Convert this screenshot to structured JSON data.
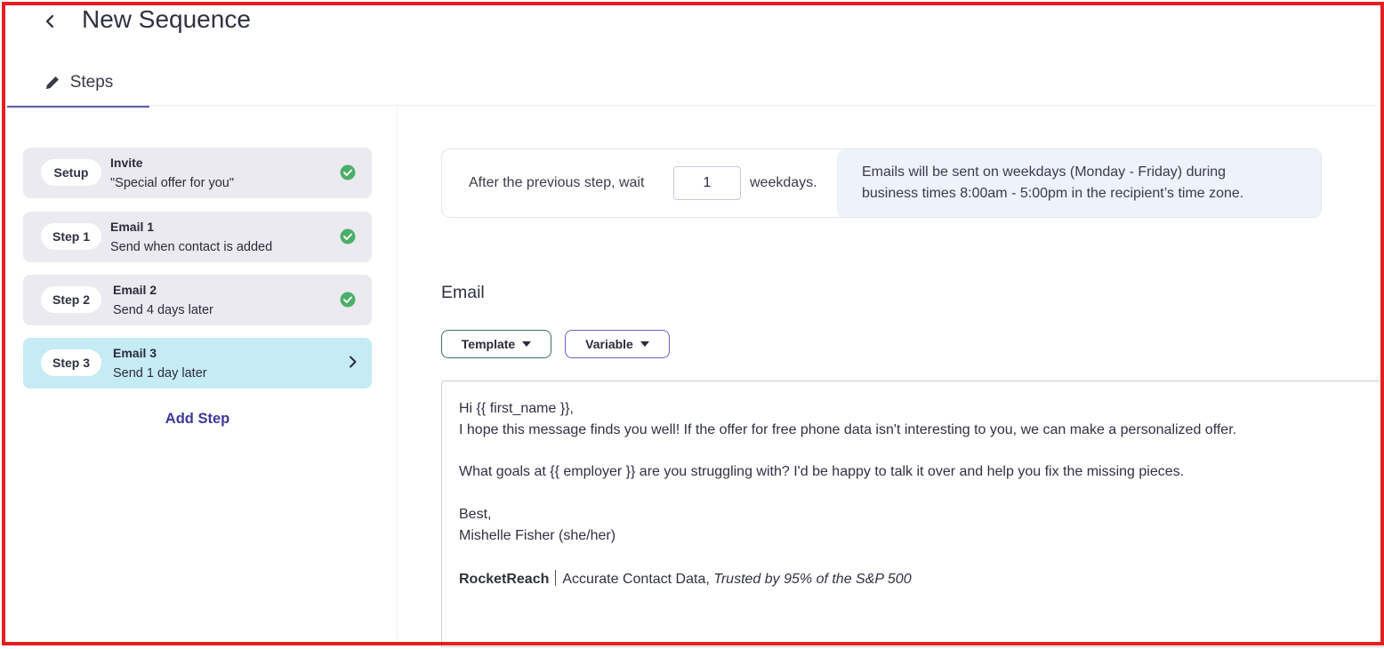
{
  "header": {
    "title": "New Sequence",
    "back_icon": "chevron-left-icon"
  },
  "tabs": [
    {
      "label": "Steps",
      "icon": "pencil-icon",
      "active": true
    }
  ],
  "steps": [
    {
      "pill": "Setup",
      "title": "Invite",
      "subtitle": "\"Special offer for you\"",
      "status": "complete",
      "active": false
    },
    {
      "pill": "Step 1",
      "title": "Email 1",
      "subtitle": "Send when contact is added",
      "status": "complete",
      "active": false
    },
    {
      "pill": "Step 2",
      "title": "Email 2",
      "subtitle": "Send 4 days later",
      "status": "complete",
      "active": false
    },
    {
      "pill": "Step 3",
      "title": "Email 3",
      "subtitle": "Send 1 day later",
      "status": "current",
      "active": true
    }
  ],
  "add_step_label": "Add Step",
  "wait": {
    "prefix": "After the previous step, wait",
    "value": "1",
    "suffix": "weekdays.",
    "info_line1": "Emails will be sent on weekdays (Monday - Friday) during",
    "info_line2": "business times 8:00am - 5:00pm in the recipient’s time zone."
  },
  "email": {
    "heading": "Email",
    "template_label": "Template",
    "variable_label": "Variable",
    "body": {
      "greeting": "Hi {{ first_name }},",
      "line1": "I hope this message finds you well! If the offer for free phone data isn't interesting to you, we can make a personalized offer.",
      "line2": "What goals at {{ employer }} are you struggling with? I'd be happy to talk it over and help you fix the missing pieces.",
      "signoff": "Best,",
      "signer": "Mishelle Fisher (she/her)",
      "brand": "RocketReach",
      "tagline": "Accurate Contact Data,",
      "tagline_italic": "Trusted by 95% of the S&P 500"
    }
  },
  "colors": {
    "accent": "#3b3a9a",
    "active_step": "#c5ebf5",
    "step_bg": "#ebeaf1",
    "check": "#4caf6a",
    "frame": "#e32020"
  }
}
